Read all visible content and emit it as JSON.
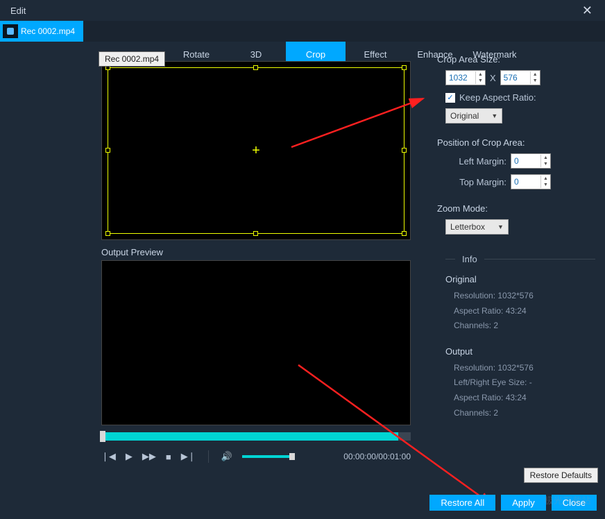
{
  "window": {
    "title": "Edit"
  },
  "file_tab": {
    "name": "Rec 0002.mp4"
  },
  "tooltip": "Rec 0002.mp4",
  "tabs": {
    "rotate": "Rotate",
    "three_d": "3D",
    "crop": "Crop",
    "effect": "Effect",
    "enhance": "Enhance",
    "watermark": "Watermark"
  },
  "preview": {
    "output_label": "Output Preview",
    "time_current": "00:00:00",
    "time_total": "00:01:00"
  },
  "crop": {
    "size_label": "Crop Area Size:",
    "width": "1032",
    "x_sep": "X",
    "height": "576",
    "keep_ar_label": "Keep Aspect Ratio:",
    "ar_dropdown": "Original",
    "position_label": "Position of Crop Area:",
    "left_margin_label": "Left Margin:",
    "left_margin_value": "0",
    "top_margin_label": "Top Margin:",
    "top_margin_value": "0",
    "zoom_label": "Zoom Mode:",
    "zoom_dropdown": "Letterbox"
  },
  "info": {
    "header": "Info",
    "original": {
      "title": "Original",
      "resolution": "Resolution: 1032*576",
      "aspect": "Aspect Ratio: 43:24",
      "channels": "Channels: 2"
    },
    "output": {
      "title": "Output",
      "resolution": "Resolution: 1032*576",
      "eye_size": "Left/Right Eye Size: -",
      "aspect": "Aspect Ratio: 43:24",
      "channels": "Channels: 2"
    }
  },
  "buttons": {
    "restore_defaults": "Restore Defaults",
    "restore_all": "Restore All",
    "apply": "Apply",
    "close": "Close"
  },
  "watermark_text": "极光下载站"
}
